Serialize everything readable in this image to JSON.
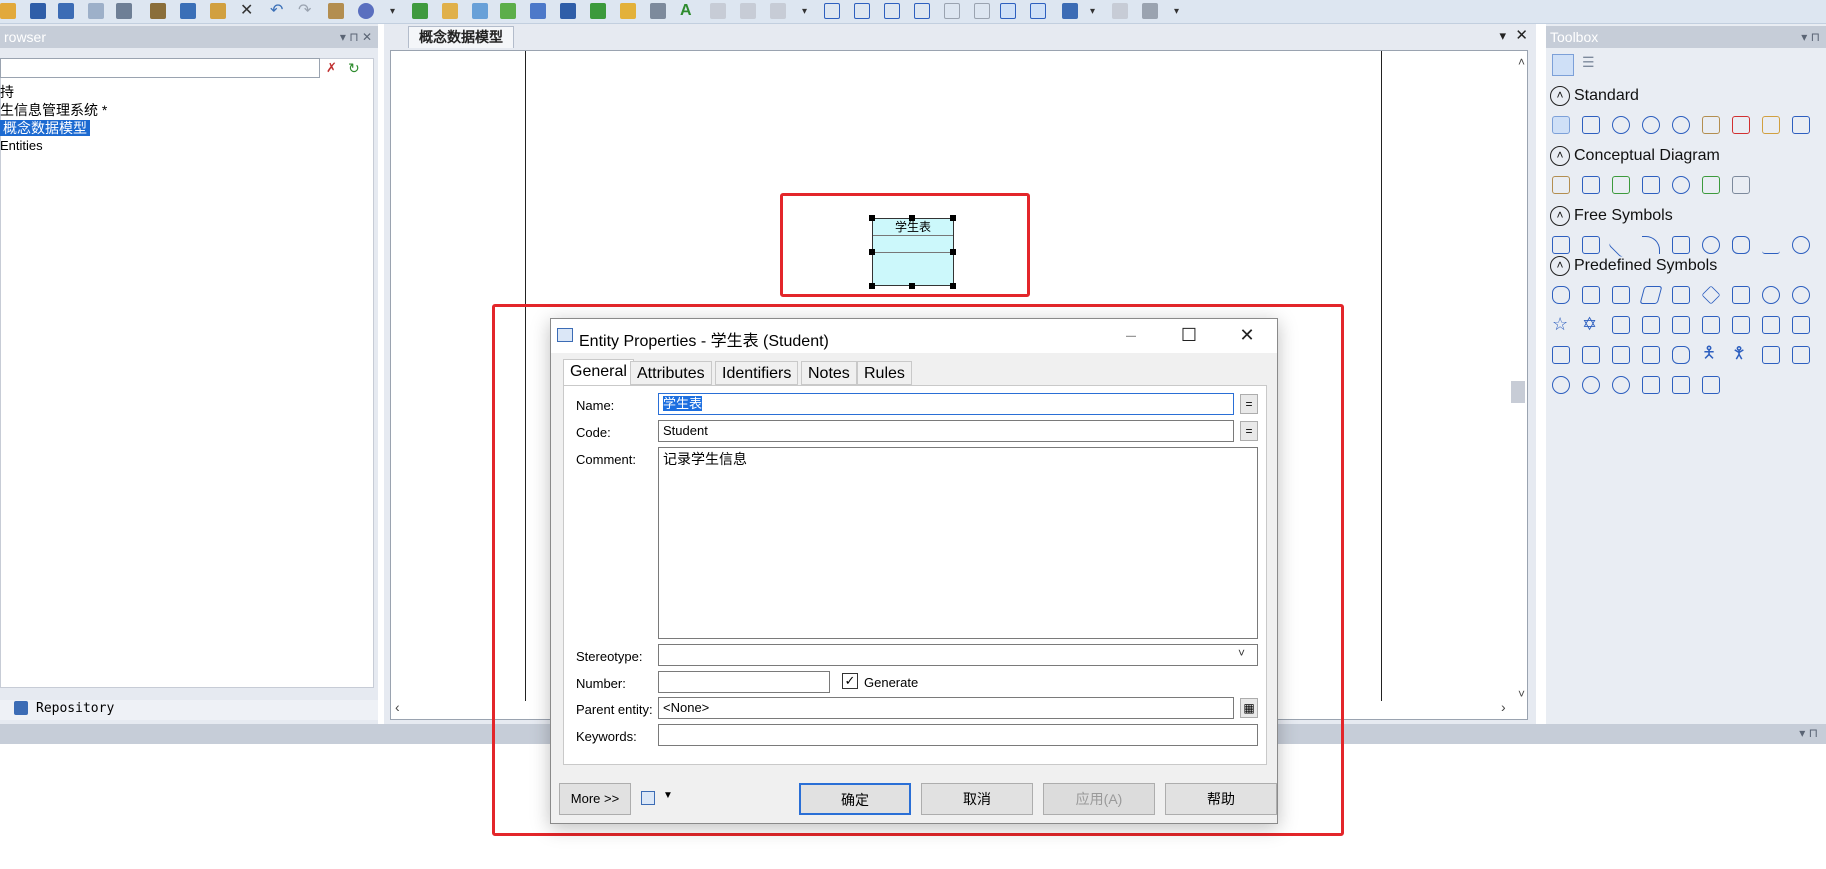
{
  "browser": {
    "title": "rowser",
    "tree": [
      {
        "label": "持"
      },
      {
        "label": "生信息管理系统 *"
      },
      {
        "label": "概念数据模型",
        "selected": true
      },
      {
        "label": "Entities"
      }
    ],
    "bottom_tab": "Repository"
  },
  "diagram": {
    "tab_title": "概念数据模型",
    "entity_name": "学生表"
  },
  "toolbox": {
    "title": "Toolbox",
    "sections": [
      {
        "label": "Standard"
      },
      {
        "label": "Conceptual Diagram"
      },
      {
        "label": "Free Symbols"
      },
      {
        "label": "Predefined Symbols"
      }
    ]
  },
  "dialog": {
    "title": "Entity Properties - 学生表 (Student)",
    "tabs": [
      {
        "label": "General",
        "active": true
      },
      {
        "label": "Attributes"
      },
      {
        "label": "Identifiers"
      },
      {
        "label": "Notes"
      },
      {
        "label": "Rules"
      }
    ],
    "fields": {
      "name_label": "Name:",
      "name_value": "学生表",
      "code_label": "Code:",
      "code_value": "Student",
      "comment_label": "Comment:",
      "comment_value": "记录学生信息",
      "stereotype_label": "Stereotype:",
      "stereotype_value": "",
      "number_label": "Number:",
      "number_value": "",
      "generate_label": "Generate",
      "generate_checked": true,
      "parent_label": "Parent entity:",
      "parent_value": "<None>",
      "keywords_label": "Keywords:",
      "keywords_value": ""
    },
    "buttons": {
      "more": "More >>",
      "ok": "确定",
      "cancel": "取消",
      "apply": "应用(A)",
      "help": "帮助"
    }
  },
  "colors": {
    "highlight_red": "#e3262a",
    "selection_blue": "#1d6fe0",
    "entity_fill": "#ccf8fb"
  }
}
